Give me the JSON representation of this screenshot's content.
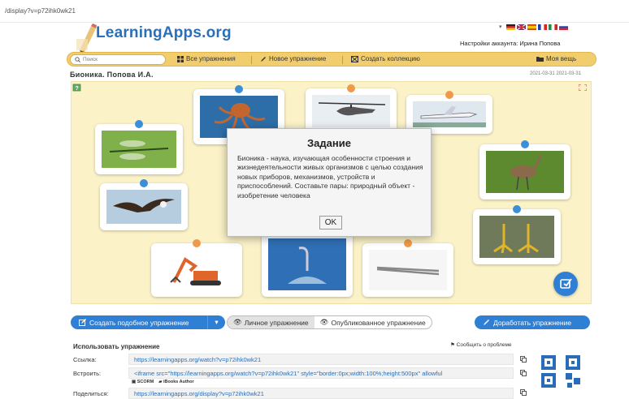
{
  "browser": {
    "url": "/display?v=p72ihk0wk21"
  },
  "header": {
    "logo_text": "LearningApps.org",
    "account_text": "Настройки аккаунта: Ирина Попова",
    "languages": [
      "de",
      "en",
      "es",
      "fr",
      "it",
      "ru"
    ]
  },
  "navbar": {
    "search_placeholder": "Поиск",
    "items": [
      {
        "label": "Все упражнения",
        "icon": "grid-icon"
      },
      {
        "label": "Новое упражнение",
        "icon": "pencil-icon"
      },
      {
        "label": "Создать коллекцию",
        "icon": "collection-icon"
      },
      {
        "label": "Моя вещь",
        "icon": "folder-icon"
      }
    ]
  },
  "page": {
    "title": "Бионика. Попова И.А.",
    "date": "2021-03-31 2021-03-31"
  },
  "exercise": {
    "cards": [
      {
        "subject": "octopus",
        "pin": "blue"
      },
      {
        "subject": "helicopter",
        "pin": "orange"
      },
      {
        "subject": "airplane",
        "pin": "orange"
      },
      {
        "subject": "dragonfly",
        "pin": "blue"
      },
      {
        "subject": "heron",
        "pin": "blue"
      },
      {
        "subject": "eagle",
        "pin": "blue"
      },
      {
        "subject": "bird-feet",
        "pin": "blue"
      },
      {
        "subject": "excavator",
        "pin": "orange"
      },
      {
        "subject": "suction-cup",
        "pin": "orange"
      },
      {
        "subject": "tweezers",
        "pin": "orange"
      }
    ],
    "modal": {
      "title": "Задание",
      "text": "Бионика - наука, изучающая особенности строения и жизнедеятельности живых организмов с целью создания новых приборов, механизмов, устройств и приспособлений. Составьте пары: природный объект - изобретение человека",
      "ok_label": "OK"
    }
  },
  "actions": {
    "create_similar": "Создать подобное упражнение",
    "private": "Личное упражнение",
    "published": "Опубликованное упражнение",
    "improve": "Доработать упражнение"
  },
  "usage": {
    "title": "Использовать упражнение",
    "report": "Сообщить о проблеме",
    "link_label": "Ссылка:",
    "link_value": "https://learningapps.org/watch?v=p72ihk0wk21",
    "embed_label": "Встроить:",
    "embed_value": "<iframe src=\"https://learningapps.org/watch?v=p72ihk0wk21\" style=\"border:0px;width:100%;height:500px\" allowful",
    "scorm": "SCORM",
    "ibooks": "iBooks Author",
    "share_label": "Поделиться:",
    "share_value": "https://learningapps.org/display?v=p72ihk0wk21",
    "qr_label": "QR-Code"
  },
  "colors": {
    "accent": "#2f7fd5",
    "nav": "#f1cd6e",
    "board": "#fbf2c8",
    "link": "#2a6fb8"
  }
}
